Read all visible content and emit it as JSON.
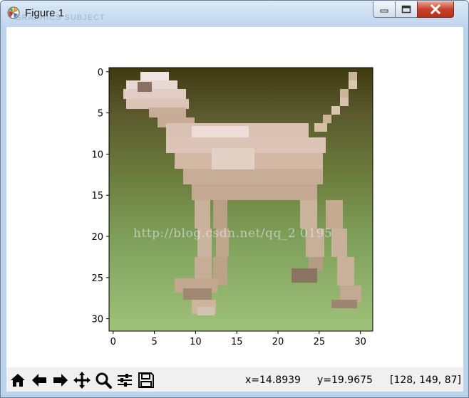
{
  "window": {
    "title": "Figure 1",
    "title_ghost": "GRAPHICS SUBJECT"
  },
  "plot": {
    "image_description_id": "dog",
    "xticks": [
      "0",
      "5",
      "10",
      "15",
      "20",
      "25",
      "30"
    ],
    "yticks": [
      "0",
      "5",
      "10",
      "15",
      "20",
      "25",
      "30"
    ],
    "xlim": [
      -0.5,
      31.5
    ],
    "ylim": [
      31.5,
      -0.5
    ]
  },
  "watermark": "http://blog.csdn.net/qq_2   0195",
  "toolbar": {
    "buttons": [
      {
        "name": "home-icon"
      },
      {
        "name": "back-arrow-icon"
      },
      {
        "name": "forward-arrow-icon"
      },
      {
        "name": "pan-icon"
      },
      {
        "name": "zoom-icon"
      },
      {
        "name": "configure-subplots-icon"
      },
      {
        "name": "save-icon"
      }
    ]
  },
  "status": {
    "x": "x=14.8939",
    "y": "y=19.9675",
    "pixel": "[128, 149, 87]"
  }
}
